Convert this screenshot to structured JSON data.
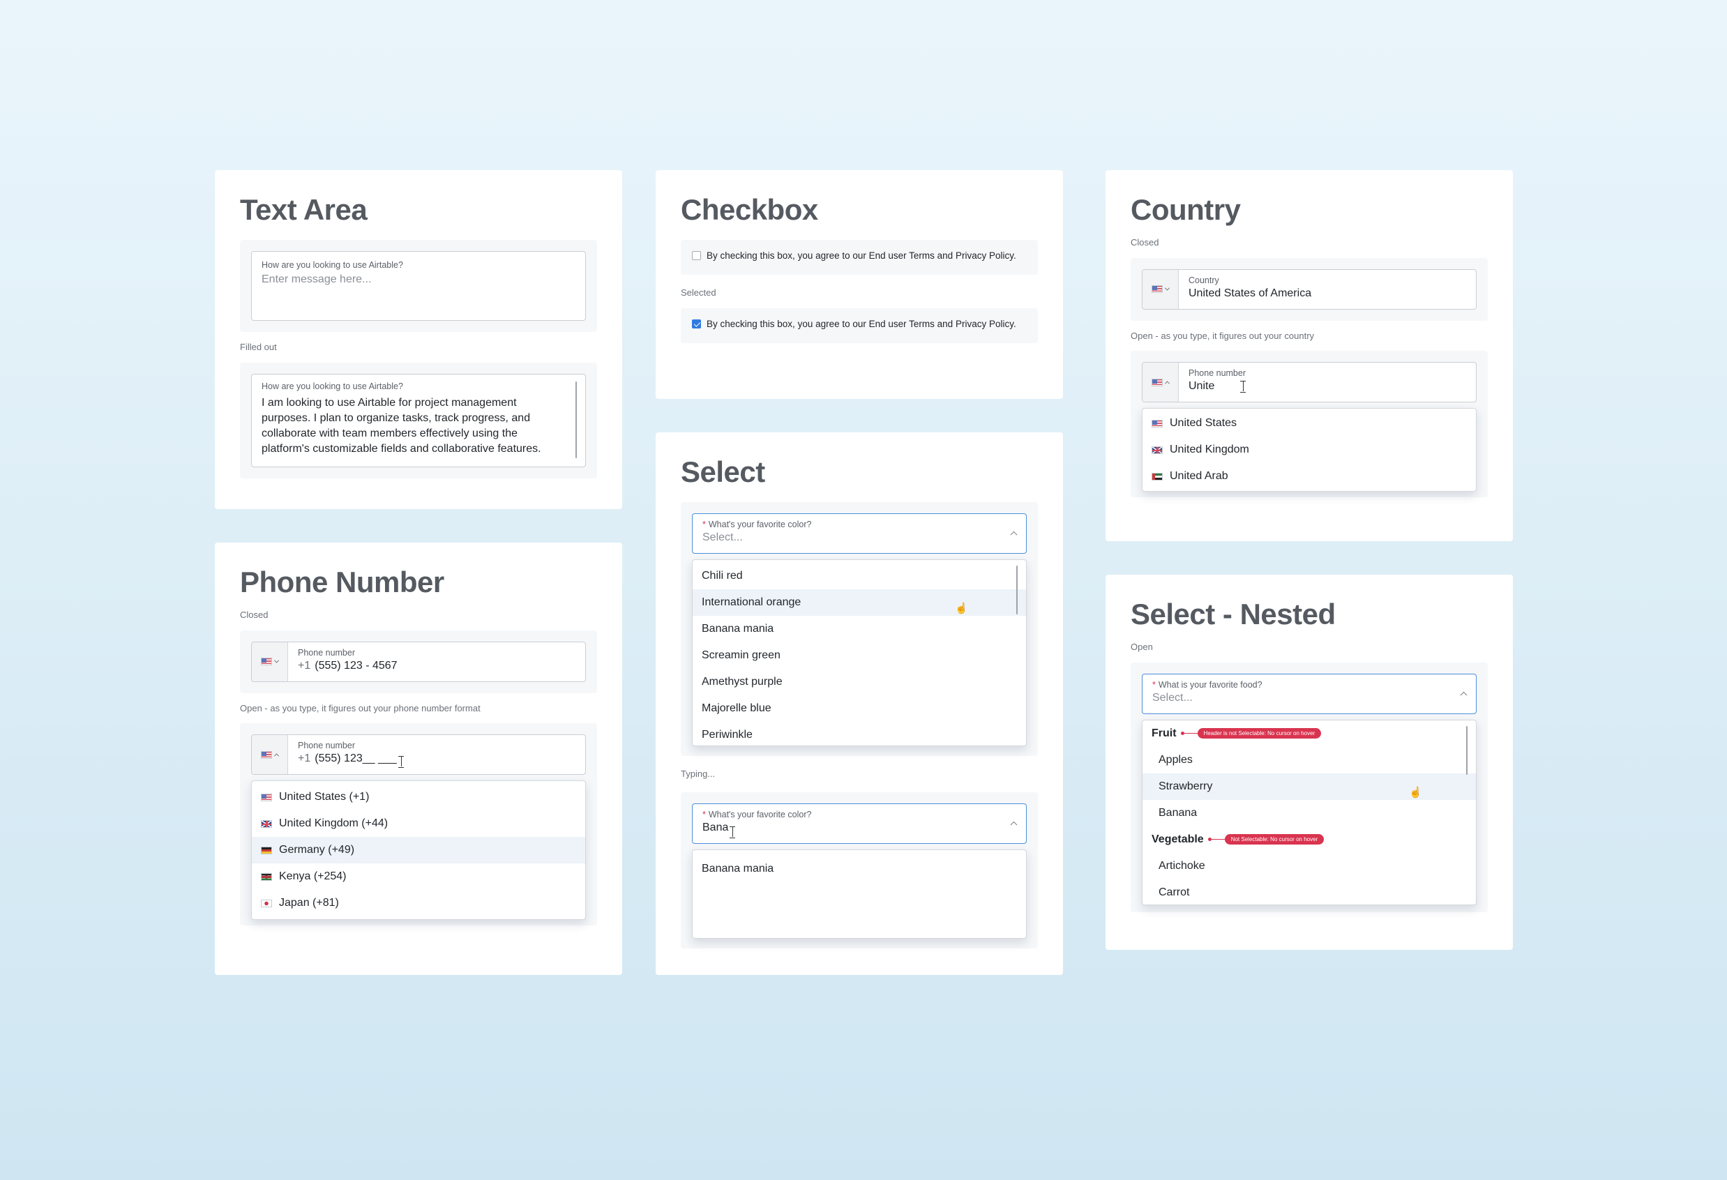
{
  "textarea": {
    "title": "Text Area",
    "empty": {
      "label": "How are you looking to use Airtable?",
      "placeholder": "Enter message here..."
    },
    "filled_caption": "Filled out",
    "filled": {
      "label": "How are you looking to use Airtable?",
      "lines": [
        "I am looking to use Airtable for project management",
        "purposes. I plan to organize tasks, track progress, and",
        "collaborate with team members effectively using the",
        "platform's customizable fields and collaborative features."
      ]
    }
  },
  "phone": {
    "title": "Phone Number",
    "closed_caption": "Closed",
    "closed": {
      "label": "Phone number",
      "prefix": "+1",
      "value": "(555)  123 - 4567",
      "flag_icon": "us-flag-icon"
    },
    "open_caption": "Open - as you type, it figures out your phone number format",
    "open": {
      "label": "Phone number",
      "prefix": "+1",
      "value": "(555)  123__  ___"
    },
    "options": [
      {
        "label": "United States (+1)",
        "flag": "us"
      },
      {
        "label": "United Kingdom (+44)",
        "flag": "gb"
      },
      {
        "label": "Germany (+49)",
        "flag": "de"
      },
      {
        "label": "Kenya (+254)",
        "flag": "ke"
      },
      {
        "label": "Japan (+81)",
        "flag": "jp"
      }
    ],
    "highlighted_index": 2
  },
  "checkbox": {
    "title": "Checkbox",
    "unchecked_text": "By checking this box, you agree to our End user Terms and Privacy Policy.",
    "selected_caption": "Selected",
    "checked_text": "By checking this box, you agree to our End user Terms and Privacy Policy.",
    "checked": true,
    "accent": "#2f7ce0"
  },
  "select": {
    "title": "Select",
    "field": {
      "label": "What's your favorite color?",
      "placeholder": "Select..."
    },
    "options": [
      "Chili red",
      "International orange",
      "Banana mania",
      "Screamin green",
      "Amethyst purple",
      "Majorelle blue",
      "Periwinkle"
    ],
    "highlighted_index": 1,
    "typing_caption": "Typing...",
    "typing": {
      "label": "What's your favorite color?",
      "value": "Bana",
      "results": [
        "Banana mania"
      ]
    }
  },
  "country": {
    "title": "Country",
    "closed_caption": "Closed",
    "closed": {
      "label": "Country",
      "value": "United States of America"
    },
    "open_caption": "Open - as you type, it figures out your country",
    "open": {
      "label": "Phone number",
      "value": "Unite"
    },
    "options": [
      {
        "label": "United States",
        "flag": "us"
      },
      {
        "label": "United Kingdom",
        "flag": "gb"
      },
      {
        "label": "United Arab",
        "flag": "ae"
      }
    ]
  },
  "nested": {
    "title": "Select - Nested",
    "open_caption": "Open",
    "field": {
      "label": "What is your favorite food?",
      "placeholder": "Select..."
    },
    "groups": [
      {
        "header": "Fruit",
        "note": "Header is not Selectable: No cursor on hover",
        "items": [
          "Apples",
          "Strawberry",
          "Banana"
        ]
      },
      {
        "header": "Vegetable",
        "note": "Not Selectable: No cursor on hover",
        "items": [
          "Artichoke",
          "Carrot"
        ]
      }
    ],
    "highlighted_item": "Strawberry"
  },
  "colors": {
    "focus_border": "#4a8fdb",
    "required": "#d9344f",
    "hover_row": "#edf3f8"
  }
}
